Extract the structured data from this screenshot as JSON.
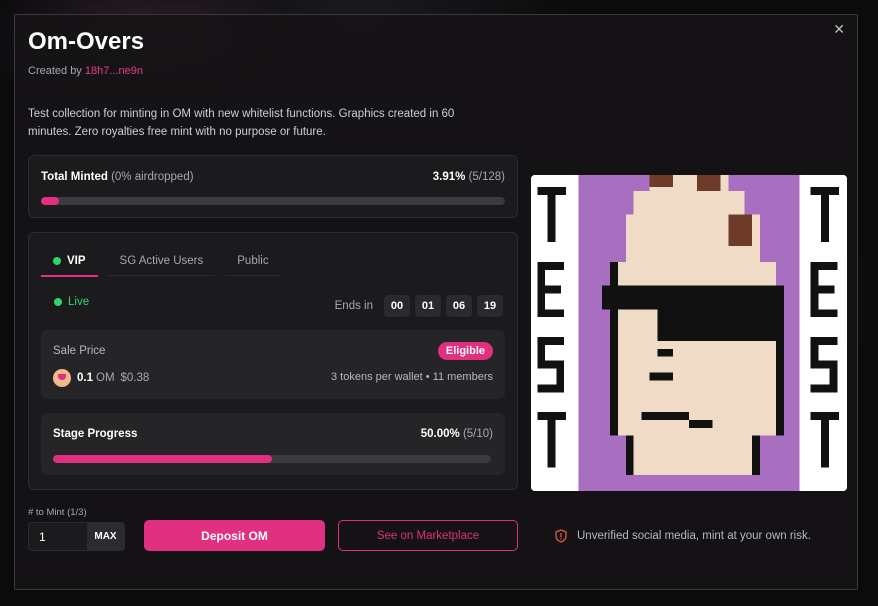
{
  "collection": {
    "title": "Om-Overs",
    "created_by_label": "Created by ",
    "creator_address": "18h7...ne9n",
    "description": "Test collection for minting in OM with new whitelist functions. Graphics created in 60 minutes. Zero royalties free mint with no purpose or future."
  },
  "total_minted": {
    "label": "Total Minted",
    "sublabel": "(0% airdropped)",
    "percent": "3.91%",
    "count": "(5/128)",
    "progress": 0.0391
  },
  "stages": {
    "tabs": [
      {
        "label": "VIP",
        "active": true
      },
      {
        "label": "SG Active Users",
        "active": false
      },
      {
        "label": "Public",
        "active": false
      }
    ],
    "status": "Live",
    "ends_in_label": "Ends in",
    "countdown": [
      "00",
      "01",
      "06",
      "19"
    ],
    "sale_price_label": "Sale Price",
    "eligible_badge": "Eligible",
    "price_amount": "0.1",
    "price_currency": "OM",
    "price_usd": "$0.38",
    "tokens_info": "3 tokens per wallet • 11 members",
    "stage_progress_label": "Stage Progress",
    "stage_percent": "50.00%",
    "stage_count": "(5/10)",
    "stage_progress": 0.5
  },
  "mint": {
    "to_mint_label": "# to Mint (1/3)",
    "quantity": "1",
    "max_label": "MAX",
    "deposit_label": "Deposit OM",
    "marketplace_label": "See on Marketplace"
  },
  "warning": {
    "text": "Unverified social media, mint at your own risk."
  },
  "colors": {
    "accent": "#e0307f",
    "live": "#33d26a",
    "art_purple": "#a86fc0",
    "art_skin": "#f0dcc6",
    "art_brown": "#6e3a2a"
  },
  "icons": {
    "close": "close-icon",
    "shield": "shield-warning-icon",
    "om_token": "om-token-icon"
  }
}
